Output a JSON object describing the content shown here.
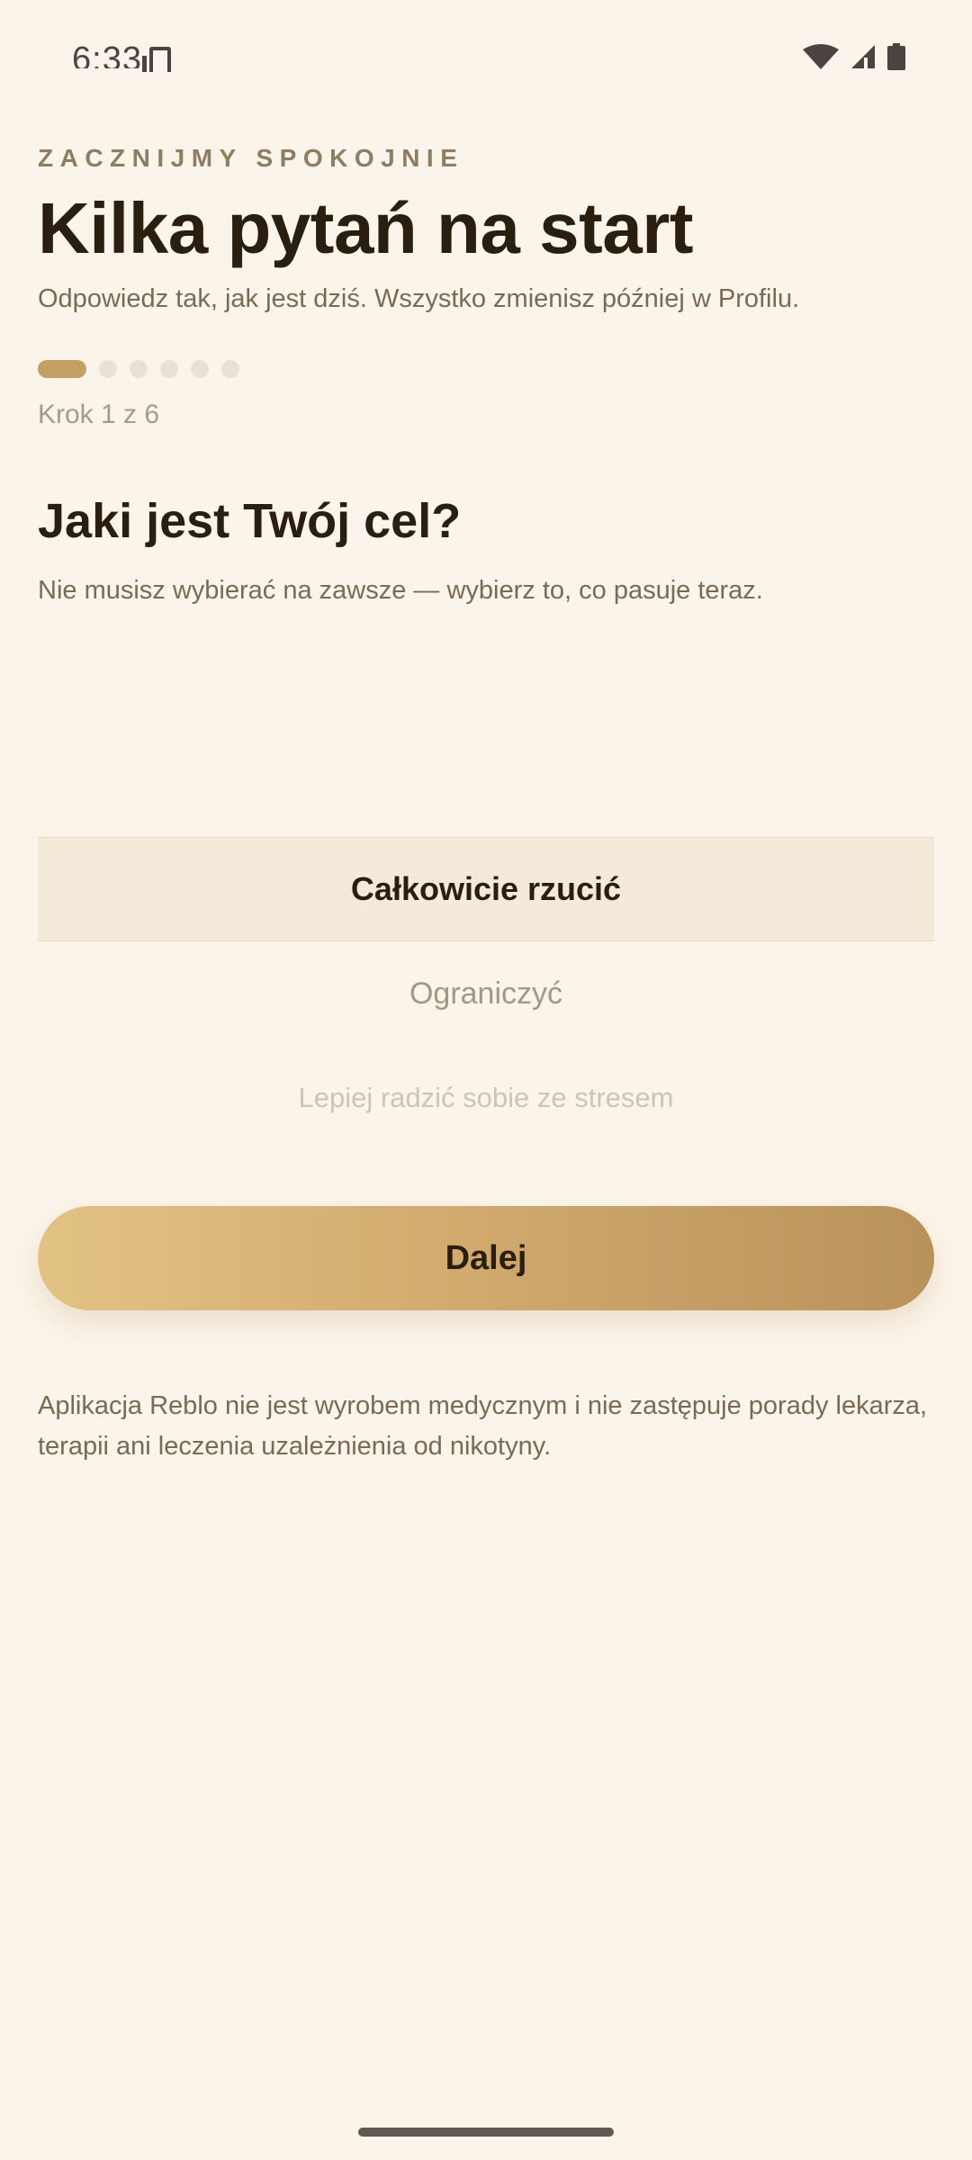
{
  "status_bar": {
    "time": "6:33",
    "icons": [
      "sim-card-icon",
      "wifi-icon",
      "signal-icon",
      "battery-icon"
    ]
  },
  "header": {
    "eyebrow": "ZACZNIJMY SPOKOJNIE",
    "title": "Kilka pytań na start",
    "subtitle": "Odpowiedz tak, jak jest dziś. Wszystko zmienisz później w Profilu."
  },
  "progress": {
    "current_step": 1,
    "total_steps": 6,
    "label": "Krok 1 z 6"
  },
  "question": {
    "title": "Jaki jest Twój cel?",
    "hint": "Nie musisz wybierać na zawsze — wybierz to, co pasuje teraz."
  },
  "picker": {
    "selected_index": 0,
    "options": [
      "Całkowicie rzucić",
      "Ograniczyć",
      "Lepiej radzić sobie ze stresem"
    ]
  },
  "actions": {
    "next_label": "Dalej"
  },
  "footer": {
    "disclaimer": "Aplikacja Reblo nie jest wyrobem medycznym i nie zastępuje porady lekarza, terapii ani leczenia uzależnienia od nikotyny."
  },
  "colors": {
    "background": "#FBF4EA",
    "accent": "#C4A064",
    "button_gradient_start": "#E2C384",
    "button_gradient_end": "#B8925B",
    "text_primary": "#2A1E10",
    "text_secondary": "#7A6A55"
  }
}
